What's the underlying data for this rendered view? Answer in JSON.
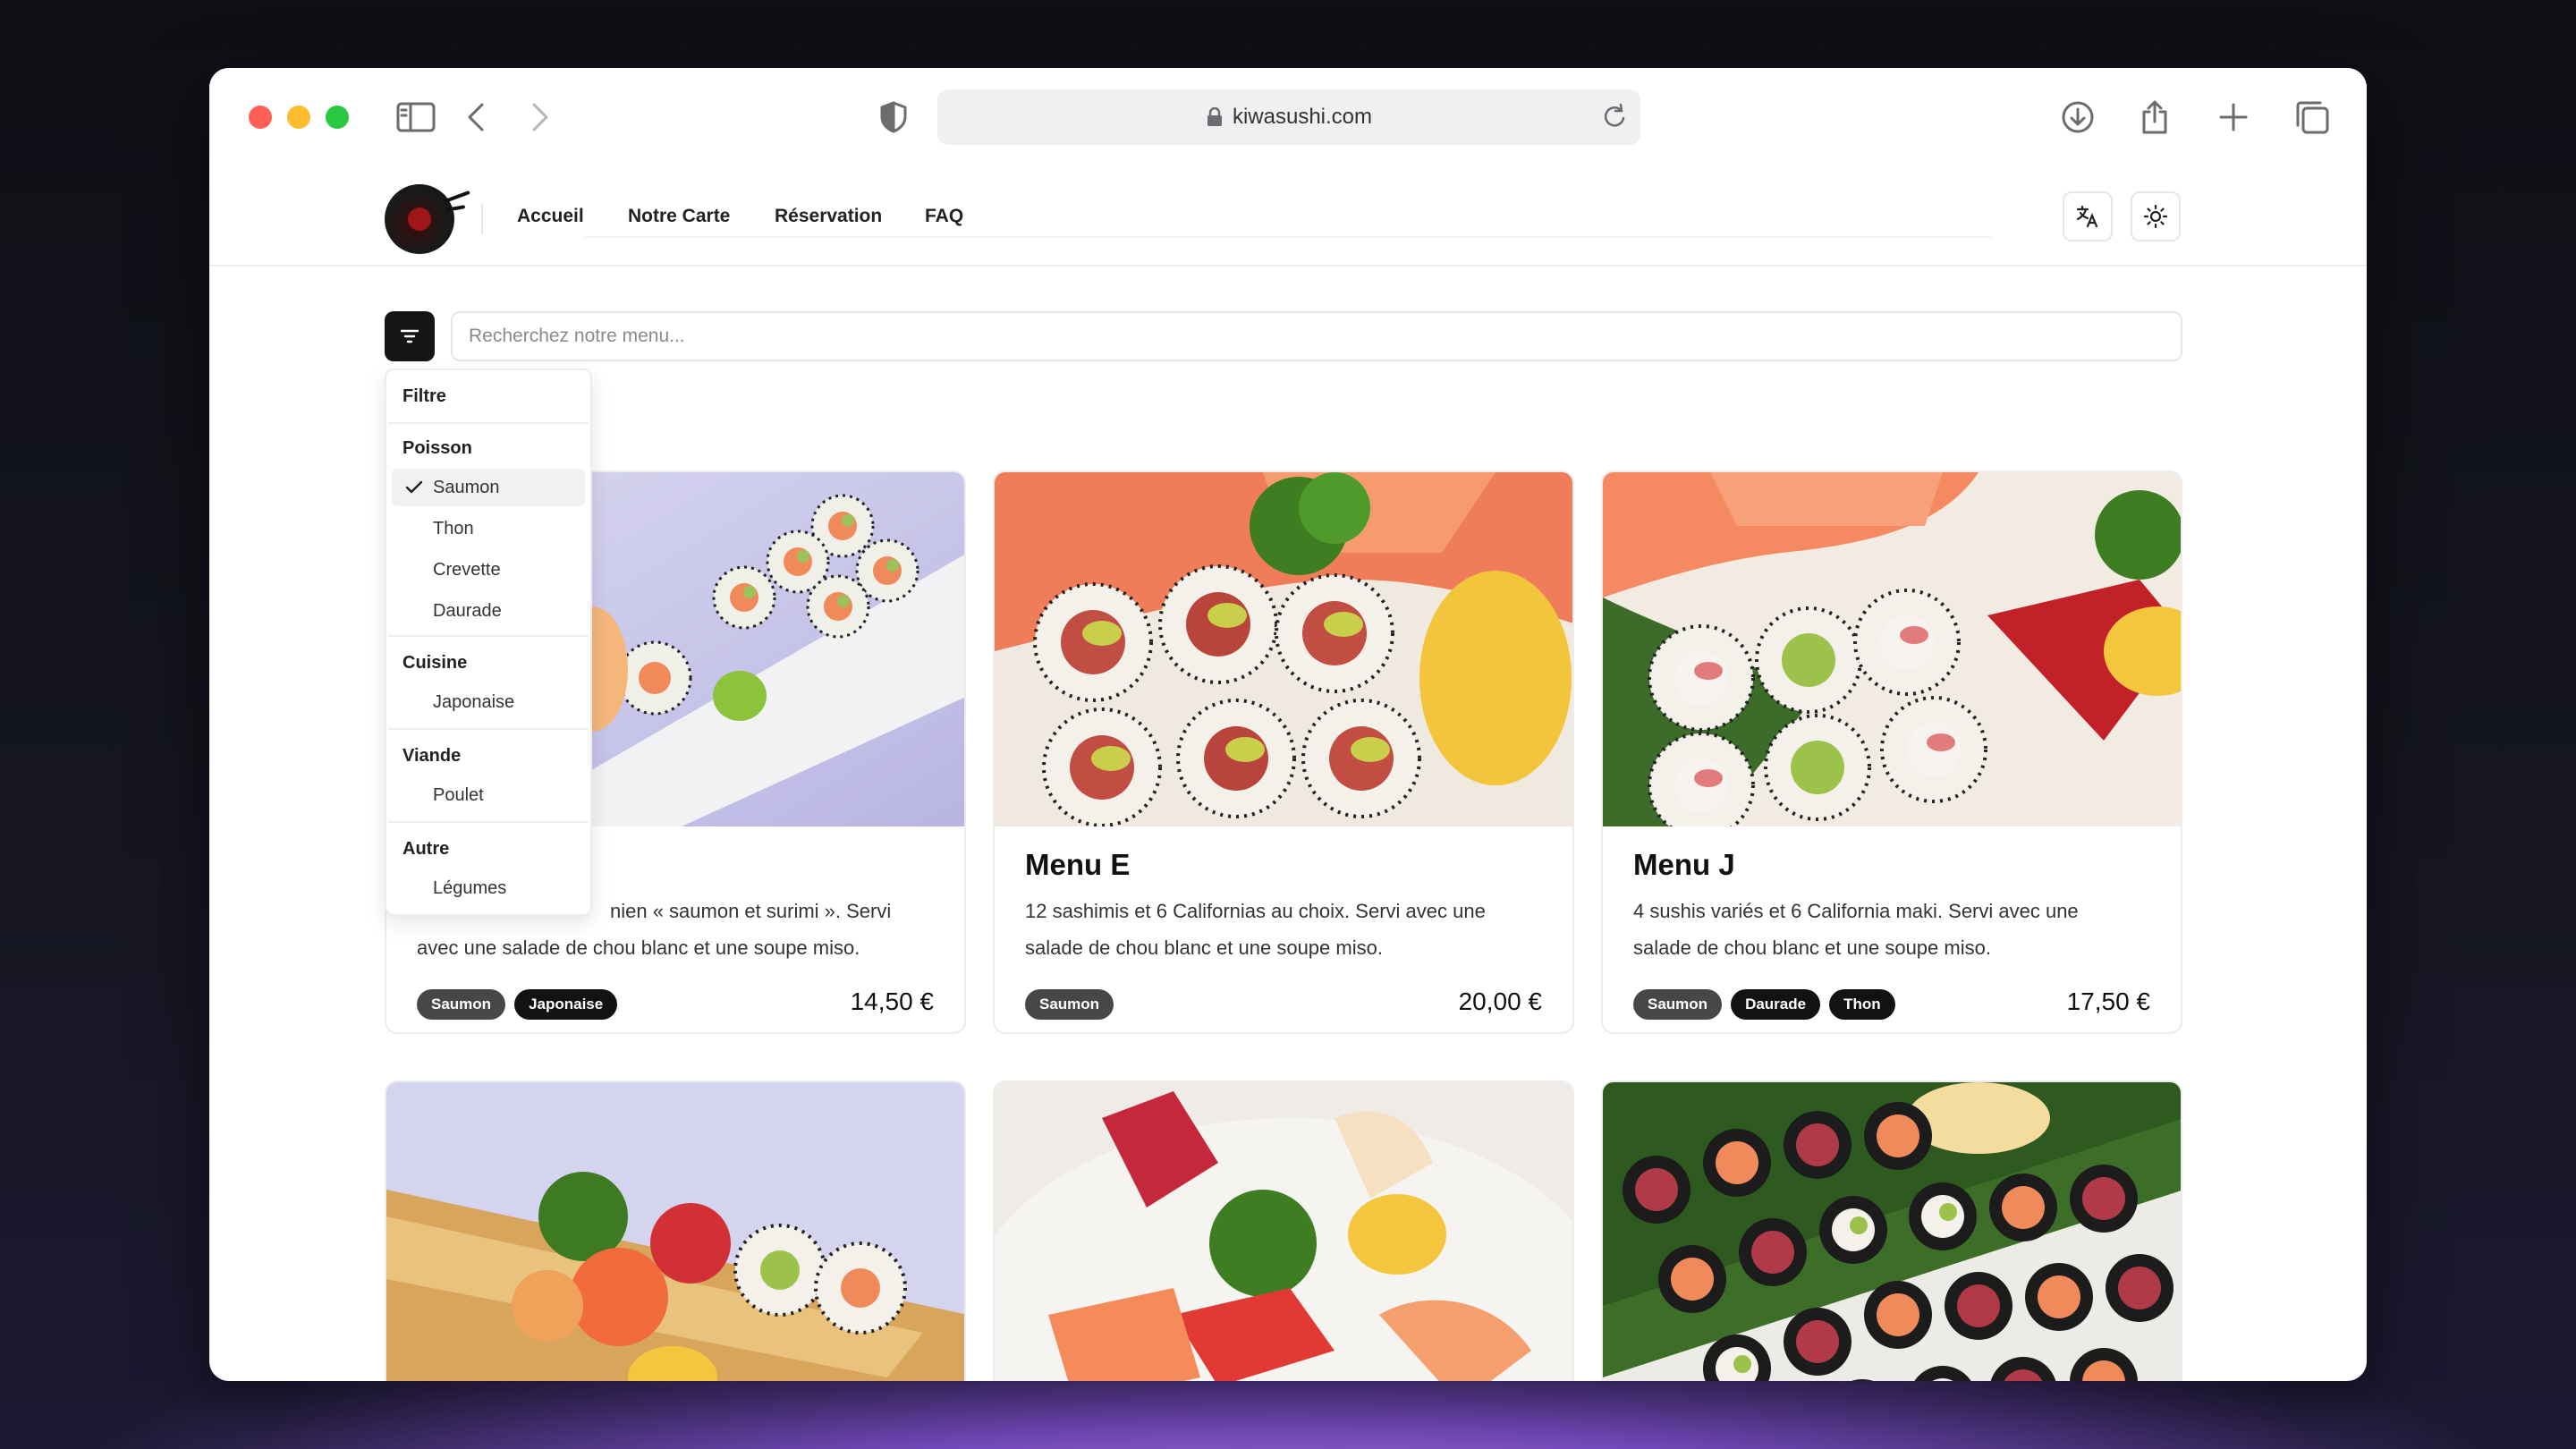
{
  "browser": {
    "url": "kiwasushi.com"
  },
  "site": {
    "nav": [
      "Accueil",
      "Notre Carte",
      "Réservation",
      "FAQ"
    ]
  },
  "search": {
    "placeholder": "Recherchez notre menu..."
  },
  "filter_dropdown": {
    "title": "Filtre",
    "groups": [
      {
        "label": "Poisson",
        "options": [
          {
            "label": "Saumon",
            "checked": true
          },
          {
            "label": "Thon",
            "checked": false
          },
          {
            "label": "Crevette",
            "checked": false
          },
          {
            "label": "Daurade",
            "checked": false
          }
        ]
      },
      {
        "label": "Cuisine",
        "options": [
          {
            "label": "Japonaise",
            "checked": false
          }
        ]
      },
      {
        "label": "Viande",
        "options": [
          {
            "label": "Poulet",
            "checked": false
          }
        ]
      },
      {
        "label": "Autre",
        "options": [
          {
            "label": "Légumes",
            "checked": false
          }
        ]
      }
    ]
  },
  "cards": [
    {
      "title": "",
      "desc_line1": "nien « saumon et surimi ». Servi",
      "desc_line2": "avec une salade de chou blanc et une soupe miso.",
      "tags": [
        "Saumon",
        "Japonaise"
      ],
      "price": "14,50 €"
    },
    {
      "title": "Menu E",
      "desc_line1": "12 sashimis et 6 Californias au choix. Servi avec une",
      "desc_line2": "salade de chou blanc et une soupe miso.",
      "tags": [
        "Saumon"
      ],
      "price": "20,00 €"
    },
    {
      "title": "Menu J",
      "desc_line1": "4 sushis variés et 6 California maki. Servi avec une",
      "desc_line2": "salade de chou blanc et une soupe miso.",
      "tags": [
        "Saumon",
        "Daurade",
        "Thon"
      ],
      "price": "17,50 €"
    }
  ],
  "colors": {
    "accent": "#151515",
    "tag_primary": "#474747",
    "tag_secondary": "#121212",
    "traffic_red": "#ff5f57",
    "traffic_yellow": "#febc2e",
    "traffic_green": "#28c840"
  }
}
